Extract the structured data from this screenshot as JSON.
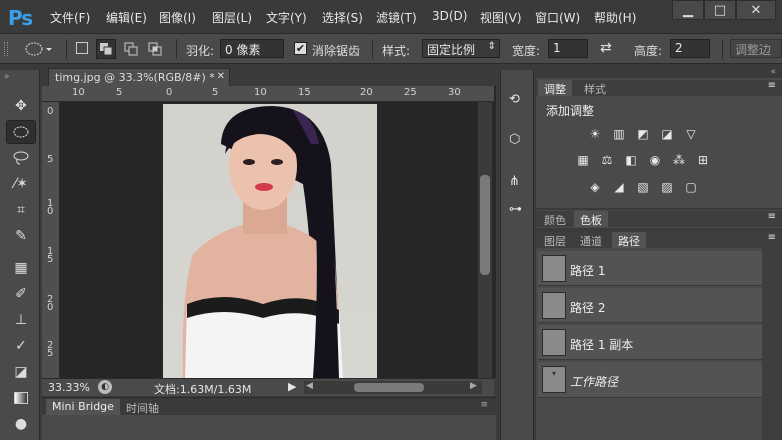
{
  "menu": {
    "logo": "Ps",
    "items": [
      "文件(F)",
      "编辑(E)",
      "图像(I)",
      "图层(L)",
      "文字(Y)",
      "选择(S)",
      "滤镜(T)",
      "3D(D)",
      "视图(V)",
      "窗口(W)",
      "帮助(H)"
    ],
    "window_buttons": [
      "▁",
      "□",
      "✕"
    ]
  },
  "options": {
    "feather_label": "羽化:",
    "feather_value": "0 像素",
    "antialias_label": "消除锯齿",
    "antialias_checked": true,
    "style_label": "样式:",
    "style_value": "固定比例",
    "width_label": "宽度:",
    "width_value": "1",
    "height_label": "高度:",
    "height_value": "2",
    "refine_button": "调整边"
  },
  "document": {
    "tab_title": "timg.jpg @ 33.3%(RGB/8#) *",
    "ruler_top": [
      "10",
      "5",
      "0",
      "5",
      "10",
      "15",
      "20",
      "25",
      "30"
    ],
    "ruler_left": [
      "0",
      "5",
      "10",
      "15",
      "20",
      "25"
    ],
    "zoom": "33.33%",
    "doc_size": "文档:1.63M/1.63M"
  },
  "bottom_tabs": [
    "Mini Bridge",
    "时间轴"
  ],
  "panels": {
    "adjust_tabs": [
      "调整",
      "样式"
    ],
    "adjust_title": "添加调整",
    "color_tabs": [
      "颜色",
      "色板"
    ],
    "layer_tabs": [
      "图层",
      "通道",
      "路径"
    ],
    "paths": [
      "路径 1",
      "路径 2",
      "路径 1 副本",
      "工作路径"
    ]
  },
  "colors": {
    "accent": "#3a9ee8",
    "panel": "#4a4a4a",
    "canvas": "#282828"
  }
}
